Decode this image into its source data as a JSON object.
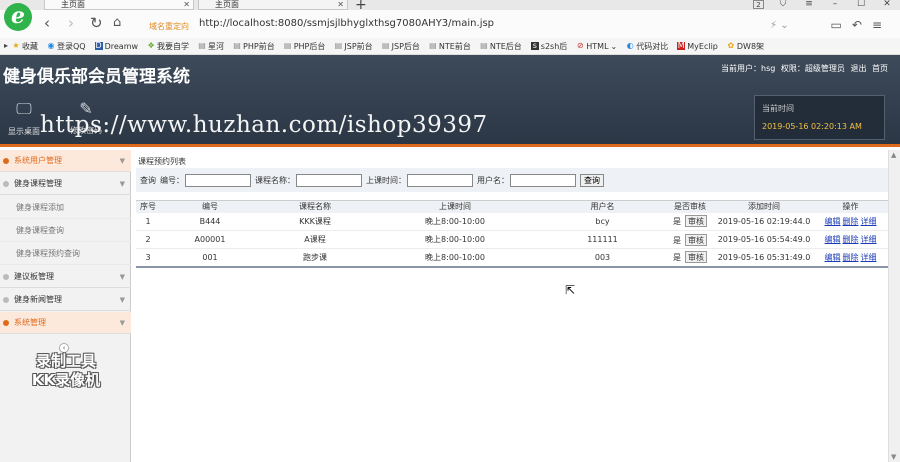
{
  "browser": {
    "tabs": [
      {
        "label": "主页面"
      },
      {
        "label": "主页面"
      }
    ],
    "tab_count": "2",
    "address_warning": "域名重定向",
    "url": "http://localhost:8080/ssmjsjlbhyglxthsg7080AHY3/main.jsp",
    "bookmarks": [
      "收藏",
      "登录QQ",
      "Dreamw",
      "我要自学",
      "星河",
      "PHP前台",
      "PHP后台",
      "JSP前台",
      "JSP后台",
      "NTE前台",
      "NTE后台",
      "s2sh后",
      "HTML",
      "代码对比",
      "MyEclip",
      "DW8架"
    ]
  },
  "header": {
    "title": "健身俱乐部会员管理系统",
    "user_label": "当前用户：hsg",
    "role_label": "权限：超级管理员",
    "logout": "退出",
    "home": "首页",
    "tools": [
      {
        "label": "显示桌面"
      },
      {
        "label": "修改密码"
      }
    ],
    "clock_label": "当前时间",
    "clock_value": "2019-05-16 02:20:13 AM",
    "watermark": "https://www.huzhan.com/ishop39397"
  },
  "sidebar": {
    "items": [
      {
        "label": "系统用户管理"
      },
      {
        "label": "健身课程管理"
      },
      {
        "label": "建议板管理"
      },
      {
        "label": "健身新闻管理"
      },
      {
        "label": "系统管理"
      }
    ],
    "subitems": [
      "健身课程添加",
      "健身课程查询",
      "健身课程预约查询"
    ],
    "recorder_watermark_line1": "录制工具",
    "recorder_watermark_line2": "KK录像机"
  },
  "main": {
    "panel_title": "课程预约列表",
    "search": {
      "prefix": "查询",
      "f1": "编号：",
      "f2": "课程名称：",
      "f3": "上课时间：",
      "f4": "用户名：",
      "button": "查询"
    },
    "columns": [
      "序号",
      "编号",
      "课程名称",
      "上课时间",
      "用户名",
      "是否审核",
      "添加时间",
      "操作"
    ],
    "rows": [
      {
        "idx": "1",
        "code": "B444",
        "course": "KKK课程",
        "time": "晚上8:00-10:00",
        "user": "bcy",
        "audited": "是",
        "audit_btn": "审核",
        "added": "2019-05-16 02:19:44.0",
        "ops": [
          "编辑",
          "删除",
          "详细"
        ]
      },
      {
        "idx": "2",
        "code": "A00001",
        "course": "A课程",
        "time": "晚上8:00-10:00",
        "user": "111111",
        "audited": "是",
        "audit_btn": "审核",
        "added": "2019-05-16 05:54:49.0",
        "ops": [
          "编辑",
          "删除",
          "详细"
        ]
      },
      {
        "idx": "3",
        "code": "001",
        "course": "跑步课",
        "time": "晚上8:00-10:00",
        "user": "003",
        "audited": "是",
        "audit_btn": "审核",
        "added": "2019-05-16 05:31:49.0",
        "ops": [
          "编辑",
          "删除",
          "详细"
        ]
      }
    ]
  }
}
